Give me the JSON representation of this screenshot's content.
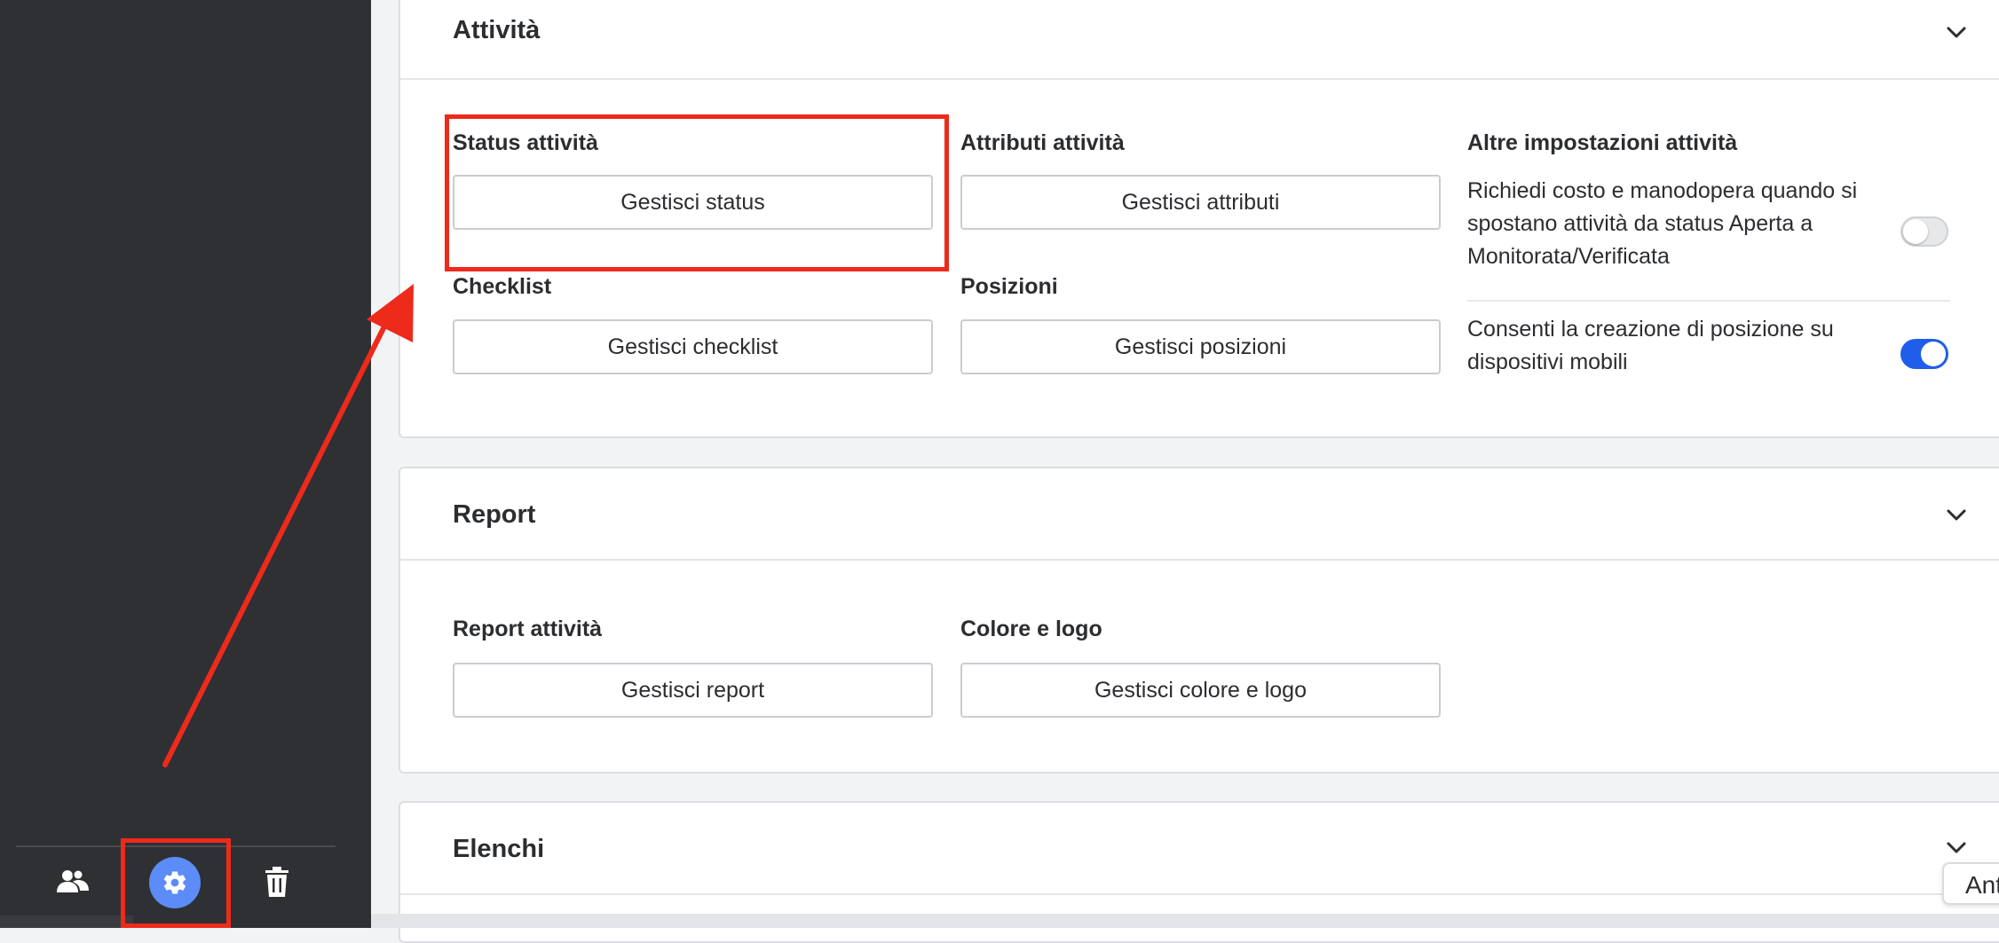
{
  "sections": {
    "attivita": {
      "title": "Attività",
      "status_label": "Status attività",
      "status_button": "Gestisci status",
      "attributi_label": "Attributi attività",
      "attributi_button": "Gestisci attributi",
      "checklist_label": "Checklist",
      "checklist_button": "Gestisci checklist",
      "posizioni_label": "Posizioni",
      "posizioni_button": "Gestisci posizioni",
      "altre_label": "Altre impostazioni attività",
      "settings": [
        {
          "text": "Richiedi costo e manodopera quando si spostano attività da status Aperta a Monitorata/Verificata",
          "enabled": false
        },
        {
          "text": "Consenti la creazione di posizione su dispositivi mobili",
          "enabled": true
        }
      ]
    },
    "report": {
      "title": "Report",
      "report_label": "Report attività",
      "report_button": "Gestisci report",
      "colore_label": "Colore e logo",
      "colore_button": "Gestisci colore e logo"
    },
    "elenchi": {
      "title": "Elenchi"
    }
  },
  "bottom_chip": "Ant",
  "icons": {
    "sidebar_users": "users-icon",
    "sidebar_settings": "gear-icon",
    "sidebar_trash": "trash-icon",
    "collapse": "chevron-down-icon"
  },
  "colors": {
    "sidebar_bg": "#2f3033",
    "gear_active": "#5b8cf7",
    "toggle_on": "#1f5eea",
    "annotation": "#ee2a1b"
  }
}
